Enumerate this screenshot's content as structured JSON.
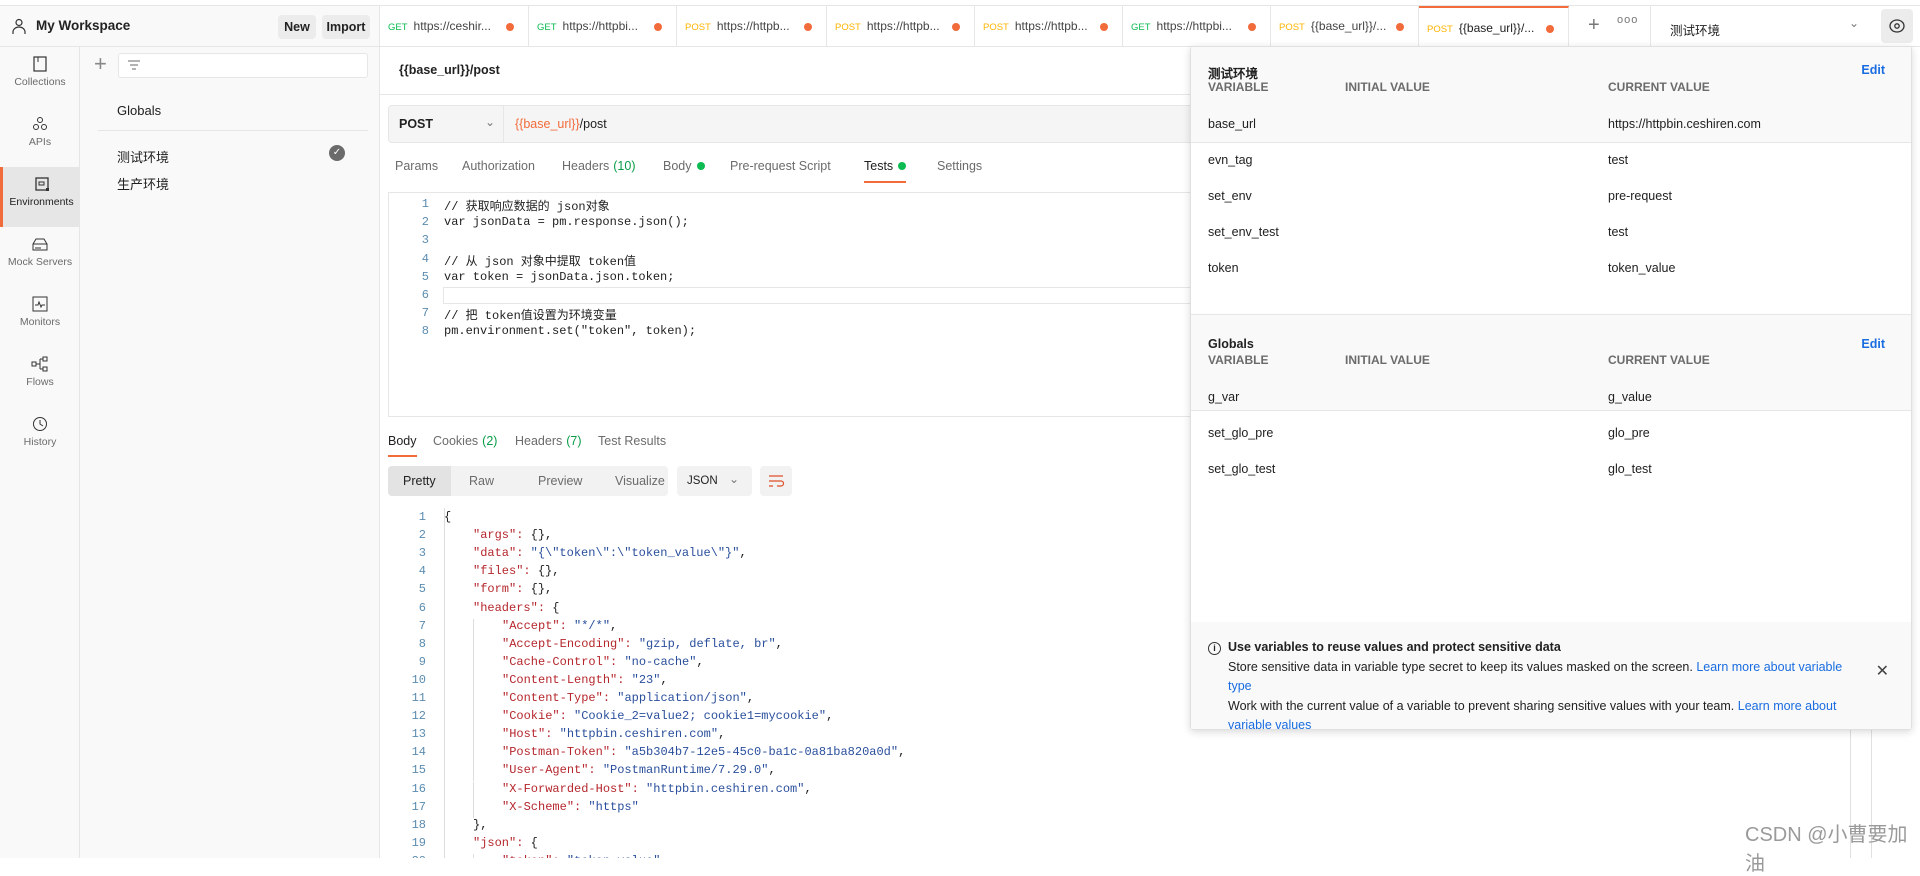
{
  "workspace": {
    "name": "My Workspace",
    "new_label": "New",
    "import_label": "Import"
  },
  "tabs": [
    {
      "method": "GET",
      "label": "https://ceshir..."
    },
    {
      "method": "GET",
      "label": "https://httpbi..."
    },
    {
      "method": "POST",
      "label": "https://httpb..."
    },
    {
      "method": "POST",
      "label": "https://httpb..."
    },
    {
      "method": "POST",
      "label": "https://httpb..."
    },
    {
      "method": "GET",
      "label": "https://httpbi..."
    },
    {
      "method": "POST",
      "label": "{{base_url}}/..."
    },
    {
      "method": "POST",
      "label": "{{base_url}}/...",
      "active": true
    }
  ],
  "env_selector": {
    "value": "测试环境"
  },
  "rail": [
    {
      "label": "Collections",
      "icon": "collections-icon"
    },
    {
      "label": "APIs",
      "icon": "apis-icon"
    },
    {
      "label": "Environments",
      "icon": "environments-icon",
      "active": true
    },
    {
      "label": "Mock Servers",
      "icon": "mock-servers-icon"
    },
    {
      "label": "Monitors",
      "icon": "monitors-icon"
    },
    {
      "label": "Flows",
      "icon": "flows-icon"
    },
    {
      "label": "History",
      "icon": "history-icon"
    }
  ],
  "envlist": {
    "globals": "Globals",
    "items": [
      {
        "name": "测试环境",
        "active": true
      },
      {
        "name": "生产环境"
      }
    ]
  },
  "request": {
    "title": "{{base_url}}/post",
    "method": "POST",
    "url_var": "{{base_url}}",
    "url_rest": "/post",
    "tabs": [
      {
        "label": "Params"
      },
      {
        "label": "Authorization"
      },
      {
        "label": "Headers",
        "count": "(10)"
      },
      {
        "label": "Body",
        "dot": true
      },
      {
        "label": "Pre-request Script"
      },
      {
        "label": "Tests",
        "dot": true,
        "active": true
      },
      {
        "label": "Settings"
      }
    ],
    "script": [
      "// 获取响应数据的 json对象",
      "var jsonData = pm.response.json();",
      "",
      "// 从 json 对象中提取 token值",
      "var token = jsonData.json.token;",
      "",
      "// 把 token值设置为环境变量",
      "pm.environment.set(\"token\", token);"
    ]
  },
  "response": {
    "tabs": [
      {
        "label": "Body",
        "active": true
      },
      {
        "label": "Cookies",
        "count": "(2)"
      },
      {
        "label": "Headers",
        "count": "(7)"
      },
      {
        "label": "Test Results"
      }
    ],
    "views": [
      "Pretty",
      "Raw",
      "Preview",
      "Visualize"
    ],
    "format": "JSON",
    "lines": [
      {
        "i": 0,
        "p": "{"
      },
      {
        "i": 1,
        "k": "args",
        "p": "{},"
      },
      {
        "i": 1,
        "k": "data",
        "v": "{\\\"token\\\":\\\"token_value\\\"}",
        "p": ","
      },
      {
        "i": 1,
        "k": "files",
        "p": "{},"
      },
      {
        "i": 1,
        "k": "form",
        "p": "{},"
      },
      {
        "i": 1,
        "k": "headers",
        "p": "{"
      },
      {
        "i": 2,
        "k": "Accept",
        "v": "*/*",
        "p": ","
      },
      {
        "i": 2,
        "k": "Accept-Encoding",
        "v": "gzip, deflate, br",
        "p": ","
      },
      {
        "i": 2,
        "k": "Cache-Control",
        "v": "no-cache",
        "p": ","
      },
      {
        "i": 2,
        "k": "Content-Length",
        "v": "23",
        "p": ","
      },
      {
        "i": 2,
        "k": "Content-Type",
        "v": "application/json",
        "p": ","
      },
      {
        "i": 2,
        "k": "Cookie",
        "v": "Cookie_2=value2; cookie1=mycookie",
        "p": ","
      },
      {
        "i": 2,
        "k": "Host",
        "v": "httpbin.ceshiren.com",
        "p": ","
      },
      {
        "i": 2,
        "k": "Postman-Token",
        "v": "a5b304b7-12e5-45c0-ba1c-0a81ba820a0d",
        "p": ","
      },
      {
        "i": 2,
        "k": "User-Agent",
        "v": "PostmanRuntime/7.29.0",
        "p": ","
      },
      {
        "i": 2,
        "k": "X-Forwarded-Host",
        "v": "httpbin.ceshiren.com",
        "p": ","
      },
      {
        "i": 2,
        "k": "X-Scheme",
        "v": "https",
        "p": ""
      },
      {
        "i": 1,
        "p": "},"
      },
      {
        "i": 1,
        "k": "json",
        "p": "{"
      },
      {
        "i": 2,
        "k": "token",
        "v": "token_value",
        "p": ""
      }
    ]
  },
  "popover": {
    "env": {
      "title": "测试环境",
      "edit": "Edit",
      "cols": [
        "VARIABLE",
        "INITIAL VALUE",
        "CURRENT VALUE"
      ],
      "rows": [
        [
          "base_url",
          "",
          "https://httpbin.ceshiren.com"
        ],
        [
          "evn_tag",
          "",
          "test"
        ],
        [
          "set_env",
          "",
          "pre-request"
        ],
        [
          "set_env_test",
          "",
          "test"
        ],
        [
          "token",
          "",
          "token_value"
        ]
      ]
    },
    "globals": {
      "title": "Globals",
      "edit": "Edit",
      "cols": [
        "VARIABLE",
        "INITIAL VALUE",
        "CURRENT VALUE"
      ],
      "rows": [
        [
          "g_var",
          "",
          "g_value"
        ],
        [
          "set_glo_pre",
          "",
          "glo_pre"
        ],
        [
          "set_glo_test",
          "",
          "glo_test"
        ]
      ]
    },
    "info": {
      "title": "Use variables to reuse values and protect sensitive data",
      "line1": "Store sensitive data in variable type secret to keep its values masked on the screen. ",
      "link1": "Learn more about variable type",
      "line2": "Work with the current value of a variable to prevent sharing sensitive values with your team. ",
      "link2": "Learn more about variable values"
    }
  },
  "watermark": "CSDN @小曹要加油",
  "colors": {
    "accent": "#f26b3a",
    "get": "#0cbb52",
    "post": "#ffb400",
    "link": "#1a6de0"
  }
}
